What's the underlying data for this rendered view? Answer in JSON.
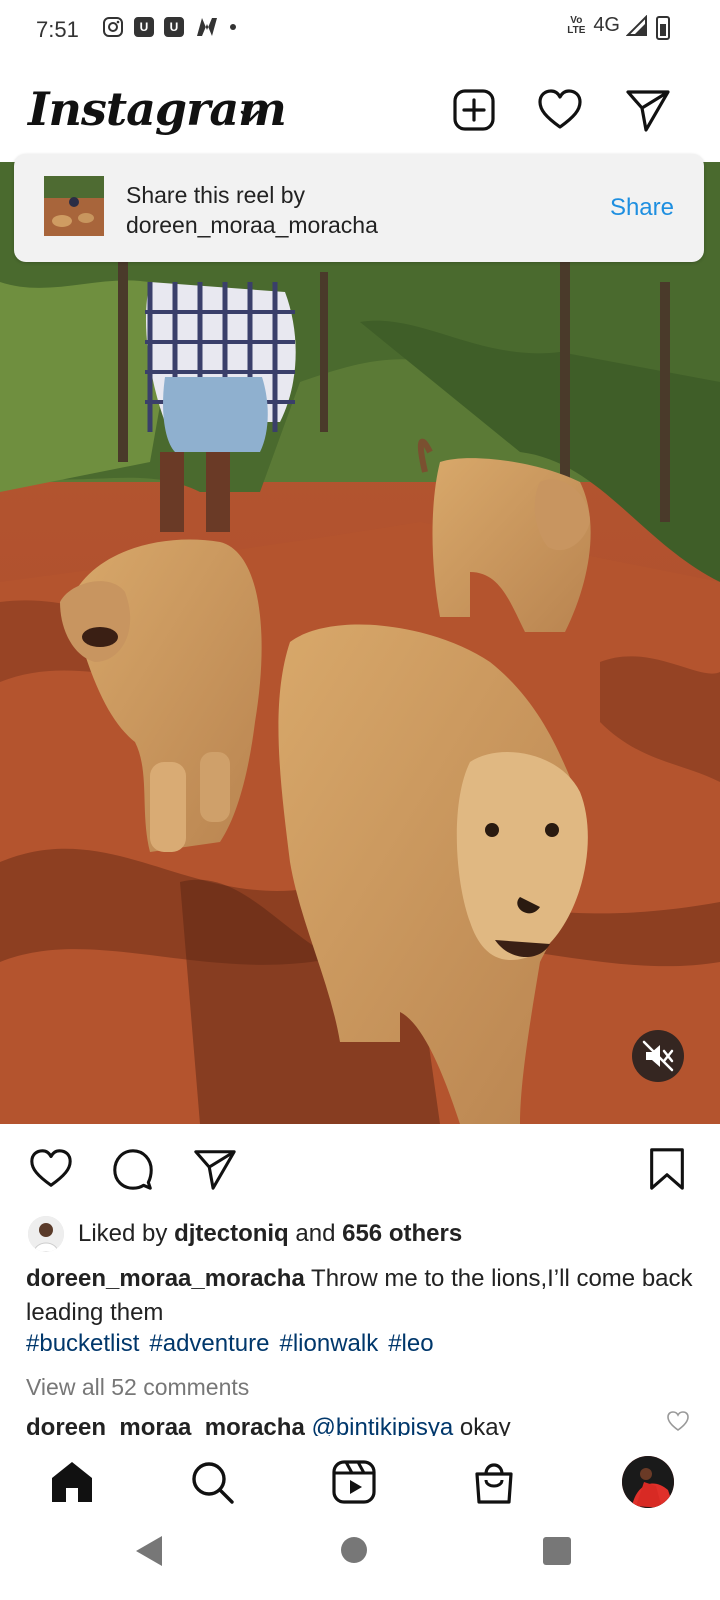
{
  "status_bar": {
    "time": "7:51",
    "network": "4G",
    "volte": "Vo LTE"
  },
  "header": {
    "logo": "Instagram",
    "icons": [
      "chevron-down-icon",
      "new-post-icon",
      "heart-icon",
      "direct-message-icon"
    ]
  },
  "share_banner": {
    "line1": "Share this reel by",
    "line2": "doreen_moraa_moracha",
    "button": "Share"
  },
  "post": {
    "liked_by_prefix": "Liked by",
    "liked_by_user": "djtectoniq",
    "liked_by_and": "and",
    "liked_by_others": "656 others",
    "caption_user": "doreen_moraa_moracha",
    "caption_text": "Throw me to the lions,I’ll come back leading them",
    "hashtags": [
      "#bucketlist",
      "#adventure",
      "#lionwalk",
      "#leo"
    ],
    "view_comments": "View all 52 comments",
    "comment_user": "doreen_moraa_moracha",
    "comment_mention": "@bintikipisya",
    "comment_text": "okay"
  },
  "colors": {
    "link_blue": "#1e8fe0",
    "hashtag_blue": "#00376b",
    "muted_gray": "#777777"
  },
  "bottom_nav": [
    "home-icon",
    "search-icon",
    "reels-icon",
    "shop-icon",
    "profile-avatar"
  ],
  "system_nav": [
    "back-icon",
    "home-circle-icon",
    "recents-icon"
  ]
}
